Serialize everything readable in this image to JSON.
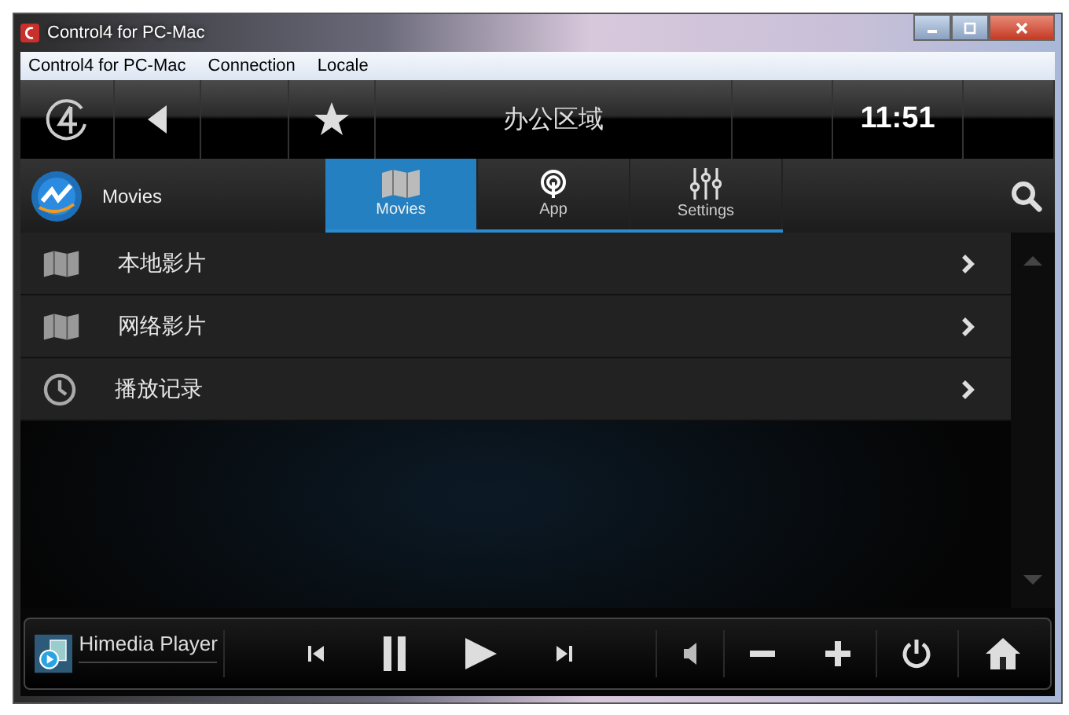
{
  "window": {
    "title": "Control4 for PC-Mac"
  },
  "menu": [
    "Control4 for PC-Mac",
    "Connection",
    "Locale"
  ],
  "header": {
    "room": "办公区域",
    "time": "11:51"
  },
  "section": {
    "title": "Movies"
  },
  "tabs": [
    {
      "label": "Movies",
      "selected": true,
      "kind": "map"
    },
    {
      "label": "App",
      "selected": false,
      "kind": "signal"
    },
    {
      "label": "Settings",
      "selected": false,
      "kind": "sliders"
    }
  ],
  "items": [
    {
      "label": "本地影片",
      "kind": "map"
    },
    {
      "label": "网络影片",
      "kind": "map"
    },
    {
      "label": "播放记录",
      "kind": "clock"
    }
  ],
  "player": {
    "title": "Himedia Player"
  }
}
